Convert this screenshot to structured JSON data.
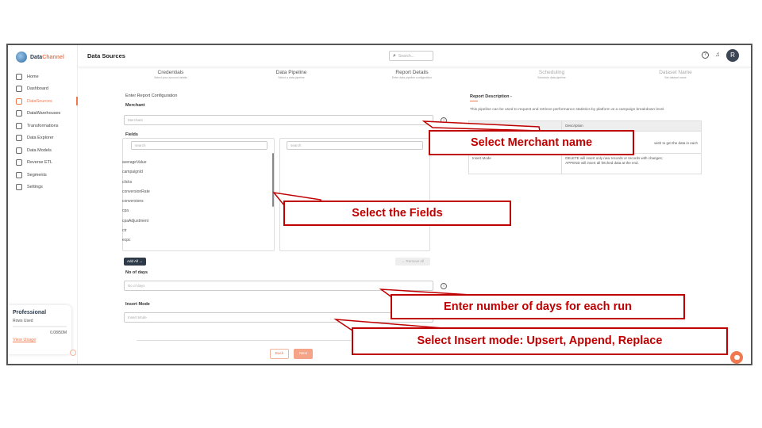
{
  "brand": {
    "name_part1": "Data",
    "name_part2": "Channel"
  },
  "sidebar": {
    "items": [
      {
        "label": "Home",
        "icon": "home-icon",
        "active": false
      },
      {
        "label": "Dashboard",
        "icon": "dashboard-icon",
        "active": false
      },
      {
        "label": "DataSources",
        "icon": "datasources-icon",
        "active": true
      },
      {
        "label": "DataWarehouses",
        "icon": "datawarehouse-icon",
        "active": false
      },
      {
        "label": "Transformations",
        "icon": "transformations-icon",
        "active": false
      },
      {
        "label": "Data Explorer",
        "icon": "explorer-icon",
        "active": false
      },
      {
        "label": "Data Models",
        "icon": "models-icon",
        "active": false
      },
      {
        "label": "Reverse ETL",
        "icon": "reverse-etl-icon",
        "active": false
      },
      {
        "label": "Segments",
        "icon": "segments-icon",
        "active": false
      },
      {
        "label": "Settings",
        "icon": "gear-icon",
        "active": false
      }
    ],
    "plan": {
      "title": "Professional",
      "rows_label": "Rows Used",
      "count": "0.08/50M",
      "link": "View Usage",
      "usage_fraction": 0.0
    }
  },
  "header": {
    "title": "Data Sources",
    "search_placeholder": "Search...",
    "avatar_letter": "R"
  },
  "steps": [
    {
      "label": "Credentials",
      "sub": "Select your account details"
    },
    {
      "label": "Data Pipeline",
      "sub": "Select a data pipeline"
    },
    {
      "label": "Report Details",
      "sub": "Enter data pipeline configuration"
    },
    {
      "label": "Scheduling",
      "sub": "Schedule data pipeline"
    },
    {
      "label": "Dataset Name",
      "sub": "Set dataset name"
    }
  ],
  "form": {
    "section_title": "Enter Report Configuration",
    "merchant_label": "Merchant",
    "merchant_placeholder": "Merchant",
    "fields_label": "Fields",
    "left_search": "search",
    "right_search": "search",
    "field_items": [
      "averageValue",
      "campaignId",
      "clicks",
      "conversionRate",
      "conversions",
      "cpa",
      "cpaAdjustment",
      "ctr",
      "ecpc"
    ],
    "add_all": "Add All →",
    "remove_all": "← Remove All",
    "days_label": "No of days",
    "days_placeholder": "No of days",
    "insert_label": "Insert Mode",
    "insert_placeholder": "Insert Mode",
    "back": "Back",
    "next": "Next"
  },
  "description": {
    "title": "Report Description -",
    "text": "This pipeline can be used to request and retrieve performance statistics by platform at a campaign breakdown level.",
    "header_col2": "Description",
    "row1_col2": "wish to get the data in each",
    "row2_col1": "Insert Mode",
    "row2_col2a": "DELETE will insert only new records or records with changes;",
    "row2_col2b": "APPEND will insert all fetched data at the end."
  },
  "callouts": {
    "merchant": "Select Merchant name",
    "fields": "Select the Fields",
    "days": "Enter number of days for each run",
    "insert": "Select Insert mode: Upsert, Append, Replace"
  },
  "colors": {
    "accent": "#ef7a50",
    "callout": "#c00000",
    "dark_button": "#2f3a48"
  }
}
